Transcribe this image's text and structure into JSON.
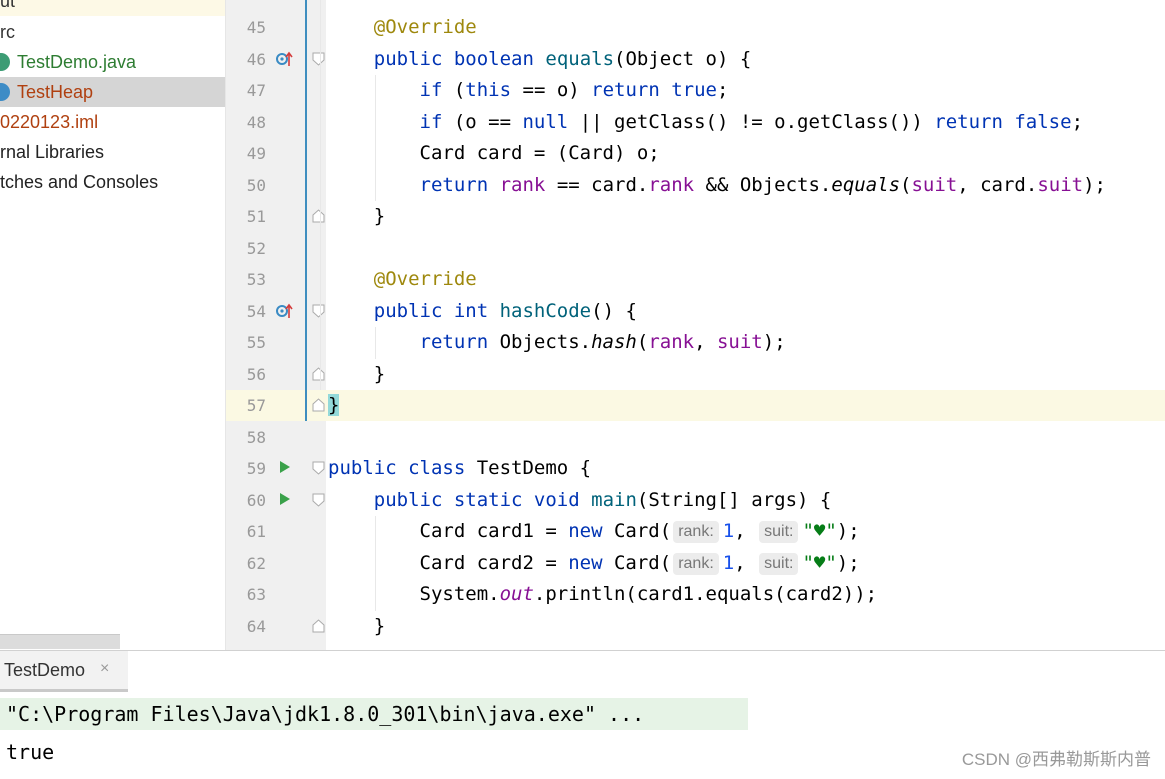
{
  "project_tree": {
    "items": [
      {
        "label": "ut",
        "color": "#333333",
        "icon": ""
      },
      {
        "label": "rc",
        "color": "#333333",
        "icon": ""
      },
      {
        "label": "TestDemo.java",
        "color": "#2e7d32",
        "icon": "java-class-icon"
      },
      {
        "label": "TestHeap",
        "color": "#b04010",
        "icon": "class-icon",
        "selected": true
      },
      {
        "label": "0220123.iml",
        "color": "#b04010",
        "icon": ""
      },
      {
        "label": "rnal Libraries",
        "color": "#222222",
        "icon": ""
      },
      {
        "label": "tches and Consoles",
        "color": "#222222",
        "icon": ""
      }
    ]
  },
  "editor": {
    "line_numbers": [
      "45",
      "46",
      "47",
      "48",
      "49",
      "50",
      "51",
      "52",
      "53",
      "54",
      "55",
      "56",
      "57",
      "58",
      "59",
      "60",
      "61",
      "62",
      "63",
      "64"
    ],
    "hints": {
      "rank": "rank:",
      "suit": "suit:"
    },
    "hint_values": {
      "rank": "1,",
      "suit": "\"♥\");"
    }
  },
  "run_panel": {
    "tab_label": "TestDemo",
    "tab_close": "×",
    "command": "\"C:\\Program Files\\Java\\jdk1.8.0_301\\bin\\java.exe\" ...",
    "output": "true"
  },
  "watermark": "CSDN @西弗勒斯斯内普",
  "colors": {
    "keyword": "#0033b3",
    "annotation": "#9e880d",
    "field": "#871094",
    "method": "#00627a",
    "string": "#067d17",
    "current_line": "#fbf9e3"
  }
}
